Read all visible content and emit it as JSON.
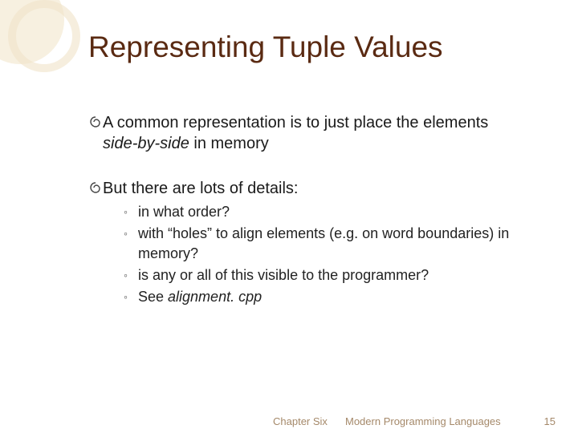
{
  "title": "Representing Tuple Values",
  "bullets": [
    {
      "text_pre": "A common representation is to just place the elements ",
      "text_ital": "side-by-side",
      "text_post": " in memory",
      "subs": []
    },
    {
      "text_pre": "But there are lots of details:",
      "text_ital": "",
      "text_post": "",
      "subs": [
        {
          "pre": "in what order?",
          "ital": "",
          "post": ""
        },
        {
          "pre": "with “holes” to align elements (e.g. on word boundaries) in memory?",
          "ital": "",
          "post": ""
        },
        {
          "pre": "is any or all of this visible to the programmer?",
          "ital": "",
          "post": ""
        },
        {
          "pre": "See ",
          "ital": "alignment. cpp",
          "post": ""
        }
      ]
    }
  ],
  "footer": {
    "chapter": "Chapter Six",
    "book": "Modern Programming Languages",
    "page": "15"
  }
}
